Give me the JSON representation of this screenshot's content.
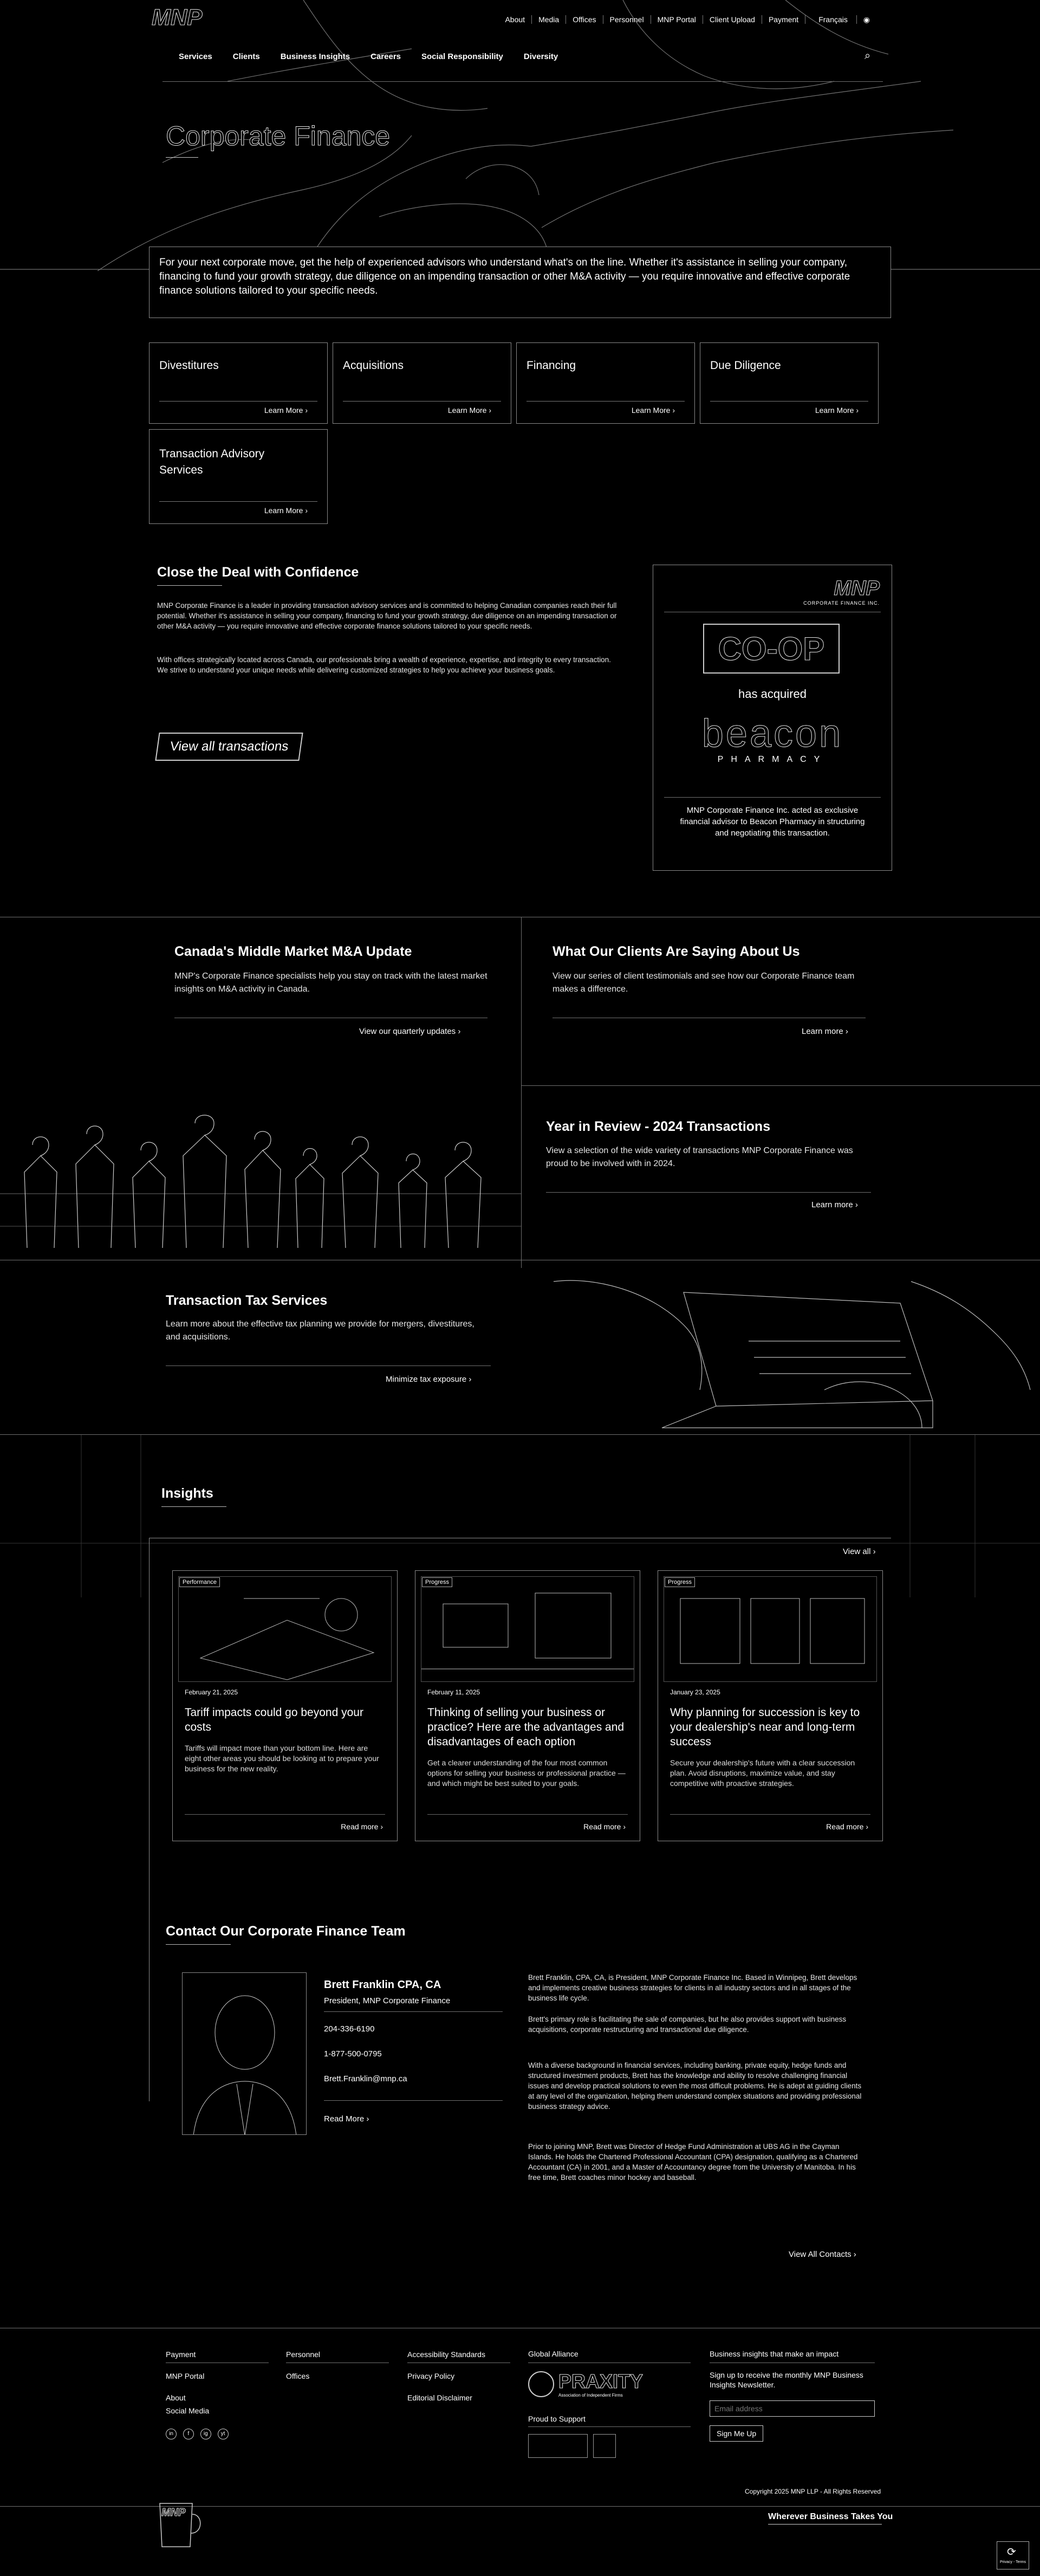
{
  "brand": {
    "logo": "MNP",
    "corp_logo_sub": "CORPORATE FINANCE INC."
  },
  "util_nav": [
    "About",
    "Media",
    "Offices",
    "Personnel",
    "MNP Portal",
    "Client Upload",
    "Payment",
    "Français"
  ],
  "main_nav": [
    "Services",
    "Clients",
    "Business Insights",
    "Careers",
    "Social Responsibility",
    "Diversity"
  ],
  "hero": {
    "title": "Corporate Finance",
    "intro": "For your next corporate move, get the help of experienced advisors who understand what's on the line. Whether it's assistance in selling your company, financing to fund your growth strategy, due diligence on an impending transaction or other M&A activity — you require innovative and effective corporate finance solutions tailored to your specific needs."
  },
  "service_cards": [
    {
      "title": "Divestitures",
      "link": "Learn More"
    },
    {
      "title": "Acquisitions",
      "link": "Learn More"
    },
    {
      "title": "Financing",
      "link": "Learn More"
    },
    {
      "title": "Due Diligence",
      "link": "Learn More"
    },
    {
      "title": "Transaction Advisory Services",
      "link": "Learn More"
    }
  ],
  "confidence": {
    "title": "Close the Deal with Confidence",
    "p1": "MNP Corporate Finance is a leader in providing transaction advisory services and is committed to helping Canadian companies reach their full potential. Whether it's assistance in selling your company, financing to fund your growth strategy, due diligence on an impending transaction or other M&A activity — you require innovative and effective corporate finance solutions tailored to your specific needs.",
    "p2": "With offices strategically located across Canada, our professionals bring a wealth of experience, expertise, and integrity to every transaction. We strive to understand your unique needs while delivering customized strategies to help you achieve your business goals.",
    "button": "View all transactions"
  },
  "tombstone": {
    "acquirer": "CO-OP",
    "has_acquired": "has acquired",
    "target": "beacon",
    "target_sub": "PHARMACY",
    "caption": "MNP Corporate Finance Inc. acted as exclusive financial advisor to Beacon Pharmacy in structuring and negotiating this transaction."
  },
  "promos": {
    "mid_market": {
      "title": "Canada's Middle Market M&A Update",
      "desc": "MNP's Corporate Finance specialists help you stay on track with the latest market insights on M&A activity in Canada.",
      "link": "View our quarterly updates"
    },
    "clients": {
      "title": "What Our Clients Are Saying About Us",
      "desc": "View our series of client testimonials and see how our Corporate Finance team makes a difference.",
      "link": "Learn more"
    },
    "year_review": {
      "title": "Year in Review - 2024 Transactions",
      "desc": "View a selection of the wide variety of transactions MNP Corporate Finance was proud to be involved with in 2024.",
      "link": "Learn more"
    },
    "tax": {
      "title": "Transaction Tax Services",
      "desc": "Learn more about the effective tax planning we provide for mergers, divestitures, and acquisitions.",
      "link": "Minimize tax exposure"
    }
  },
  "insights": {
    "title": "Insights",
    "view_all": "View all",
    "cards": [
      {
        "tag": "Performance",
        "date": "February 21, 2025",
        "title": "Tariff impacts could go beyond your costs",
        "desc": "Tariffs will impact more than your bottom line. Here are eight other areas you should be looking at to prepare your business for the new reality.",
        "link": "Read more"
      },
      {
        "tag": "Progress",
        "date": "February 11, 2025",
        "title": "Thinking of selling your business or practice? Here are the advantages and disadvantages of each option",
        "desc": "Get a clearer understanding of the four most common options for selling your business or professional practice — and which might be best suited to your goals.",
        "link": "Read more"
      },
      {
        "tag": "Progress",
        "date": "January 23, 2025",
        "title": "Why planning for succession is key to your dealership's near and long-term success",
        "desc": "Secure your dealership's future with a clear succession plan. Avoid disruptions, maximize value, and stay competitive with proactive strategies.",
        "link": "Read more"
      }
    ]
  },
  "contact": {
    "title": "Contact Our Corporate Finance Team",
    "name": "Brett Franklin CPA, CA",
    "role": "President, MNP Corporate Finance",
    "phone": "204-336-6190",
    "tollfree": "1-877-500-0795",
    "email": "Brett.Franklin@mnp.ca",
    "link": "Read More",
    "bio1": "Brett Franklin, CPA, CA, is President, MNP Corporate Finance Inc. Based in Winnipeg, Brett develops and implements creative business strategies for clients in all industry sectors and in all stages of the business life cycle.",
    "bio2": "Brett's primary role is facilitating the sale of companies, but he also provides support with business acquisitions, corporate restructuring and transactional due diligence.",
    "bio3": "With a diverse background in financial services, including banking, private equity, hedge funds and structured investment products, Brett has the knowledge and ability to resolve challenging financial issues and develop practical solutions to even the most difficult problems. He is adept at guiding clients at any level of the organization, helping them understand complex situations and providing professional business strategy advice.",
    "bio4": "Prior to joining MNP, Brett was Director of Hedge Fund Administration at UBS AG in the Cayman Islands. He holds the Chartered Professional Accountant (CPA) designation, qualifying as a Chartered Accountant (CA) in 2001, and a Master of Accountancy degree from the University of Manitoba. In his free time, Brett coaches minor hockey and baseball.",
    "view_all": "View All Contacts"
  },
  "footer": {
    "col1": [
      "Payment",
      "MNP Portal",
      "About",
      "Social Media"
    ],
    "col2": [
      "Personnel",
      "Offices"
    ],
    "col3": [
      "Accessibility Standards",
      "Privacy Policy",
      "Editorial Disclaimer"
    ],
    "global_alliance": "Global Alliance",
    "praxity": "PRAXITY",
    "praxity_sub": "Association of Independent Firms",
    "proud": "Proud to Support",
    "newsletter_title": "Business insights that make an impact",
    "newsletter_desc": "Sign up to receive the monthly MNP Business Insights Newsletter.",
    "email_placeholder": "Email address",
    "signup": "Sign Me Up",
    "copyright": "Copyright 2025 MNP LLP - All Rights Reserved",
    "tagline": "Wherever Business Takes You",
    "social": [
      "in",
      "f",
      "ig",
      "yt"
    ],
    "privacy_badge": "Privacy - Terms"
  }
}
